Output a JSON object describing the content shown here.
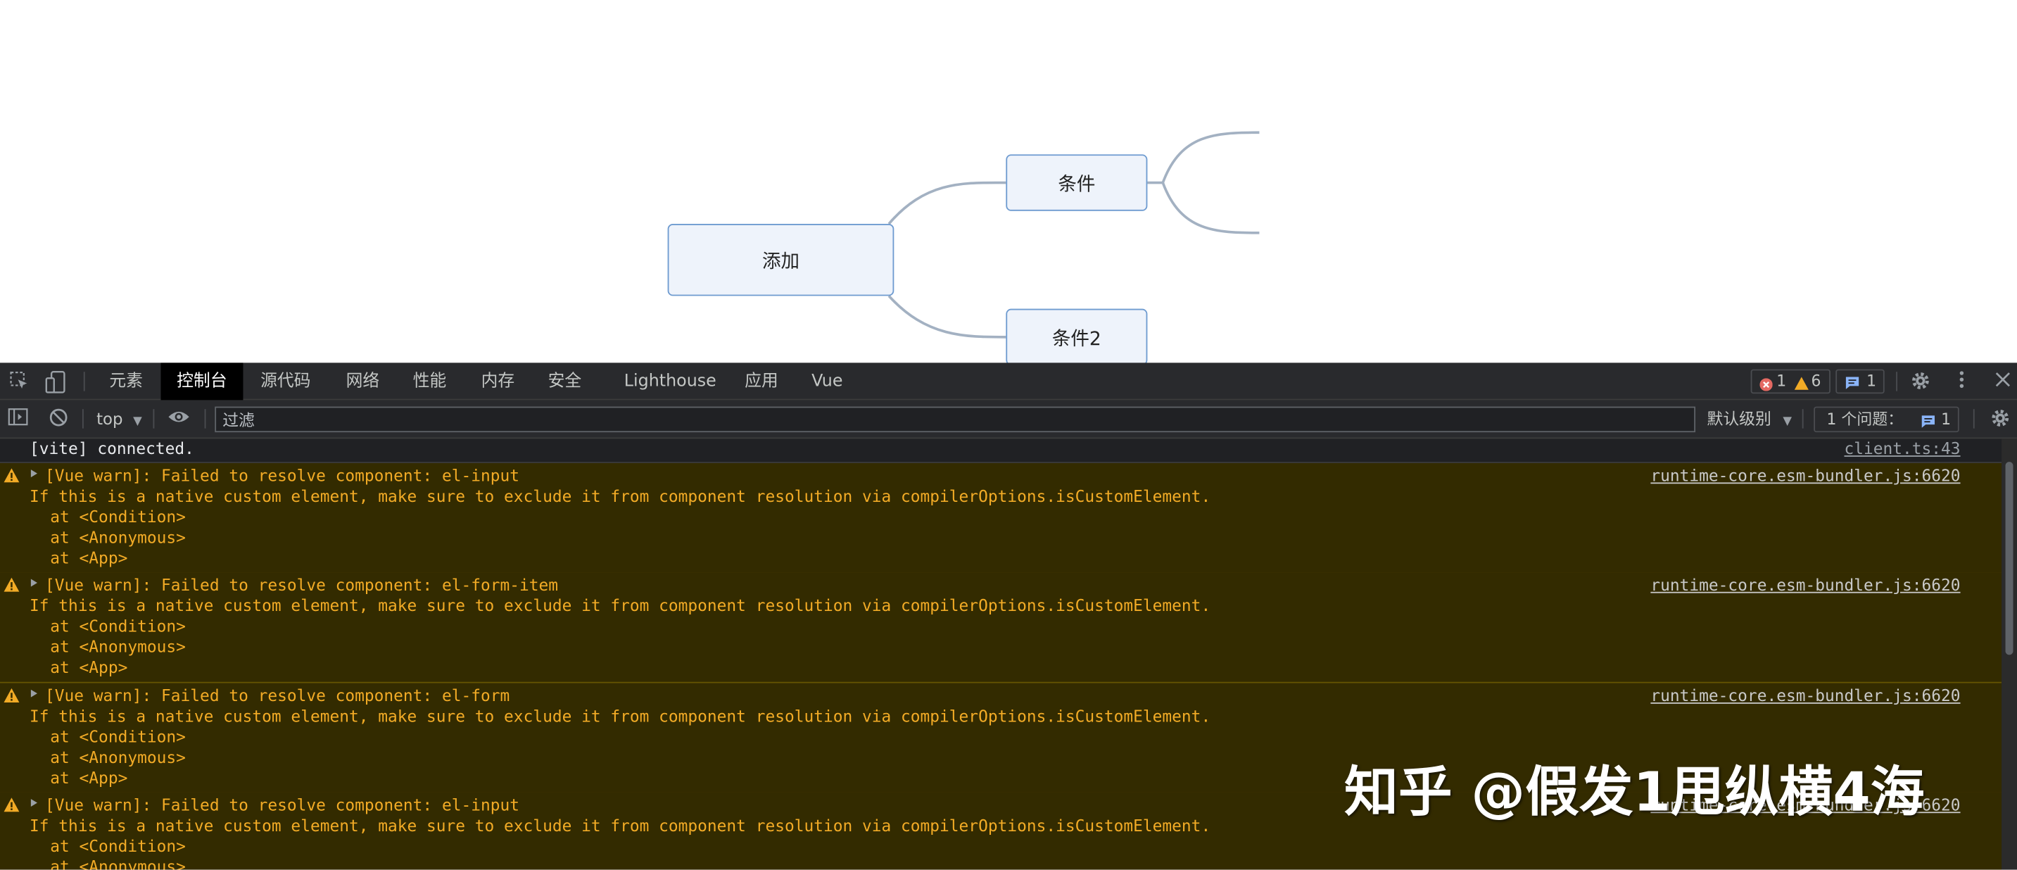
{
  "mindmap": {
    "root": "添加",
    "child1": "条件",
    "child2": "条件2"
  },
  "devtools": {
    "tabs": [
      "元素",
      "控制台",
      "源代码",
      "网络",
      "性能",
      "内存",
      "安全",
      "Lighthouse",
      "应用",
      "Vue"
    ],
    "active_tab": "控制台",
    "counts": {
      "errors": "1",
      "warnings": "6",
      "messages": "1"
    },
    "filterbar": {
      "context": "top",
      "filter_placeholder": "过滤",
      "level": "默认级别",
      "issues_label": "1 个问题：",
      "issues_count": "1"
    }
  },
  "console": {
    "info": {
      "text": "[vite] connected.",
      "source": "client.ts:43"
    },
    "warnings": [
      {
        "title": "[Vue warn]: Failed to resolve component: el-input",
        "detail": "If this is a native custom element, make sure to exclude it from component resolution via compilerOptions.isCustomElement.",
        "stack": [
          "at <Condition>",
          "at <Anonymous>",
          "at <App>"
        ],
        "source": "runtime-core.esm-bundler.js:6620"
      },
      {
        "title": "[Vue warn]: Failed to resolve component: el-form-item",
        "detail": "If this is a native custom element, make sure to exclude it from component resolution via compilerOptions.isCustomElement.",
        "stack": [
          "at <Condition>",
          "at <Anonymous>",
          "at <App>"
        ],
        "source": "runtime-core.esm-bundler.js:6620"
      },
      {
        "title": "[Vue warn]: Failed to resolve component: el-form",
        "detail": "If this is a native custom element, make sure to exclude it from component resolution via compilerOptions.isCustomElement.",
        "stack": [
          "at <Condition>",
          "at <Anonymous>",
          "at <App>"
        ],
        "source": "runtime-core.esm-bundler.js:6620"
      },
      {
        "title": "[Vue warn]: Failed to resolve component: el-input",
        "detail": "If this is a native custom element, make sure to exclude it from component resolution via compilerOptions.isCustomElement.",
        "stack": [
          "at <Condition>",
          "at <Anonymous>"
        ],
        "source": "runtime-core.esm-bundler.js:6620"
      }
    ]
  },
  "watermark": "知乎 @假发1甩纵横4海",
  "colors": {
    "node_fill": "#eef3fb",
    "node_border": "#6e9bd0",
    "connector": "#a3b1c2",
    "warn_bg": "#332b00",
    "warn_text": "#f2ab26",
    "devtools_bg": "#202124"
  },
  "icons": [
    "inspect-element-icon",
    "device-toolbar-icon",
    "error-icon",
    "warning-icon",
    "message-icon",
    "settings-icon",
    "more-icon",
    "close-icon",
    "sidebar-toggle-icon",
    "clear-console-icon",
    "eye-icon",
    "chevron-down-icon"
  ]
}
